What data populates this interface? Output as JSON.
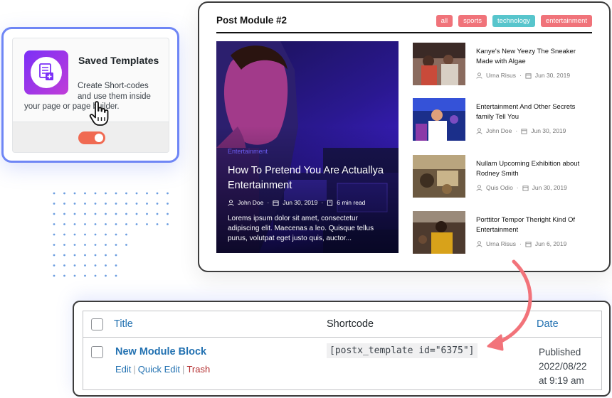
{
  "saved_templates": {
    "title": "Saved Templates",
    "description_line1": "Create Short-codes",
    "description_line2": "and use them inside",
    "description_line3": "your page or page builder.",
    "toggle_state": "on",
    "icon": "template-icon"
  },
  "post_module": {
    "title": "Post Module #2",
    "filters": [
      "all",
      "sports",
      "technology",
      "entertainment"
    ],
    "featured": {
      "category": "Entertainment",
      "headline": "How To Pretend You Are Actuallya Entertainment",
      "author": "John Doe",
      "date": "Jun 30, 2019",
      "read_time": "6 min read",
      "excerpt": "Lorems ipsum dolor sit amet, consectetur adipiscing elit. Maecenas a leo. Quisque tellus purus, volutpat eget justo quis, auctor..."
    },
    "posts": [
      {
        "title": "Kanye's New Yeezy The Sneaker Made with Algae",
        "author": "Urna Risus",
        "date": "Jun 30, 2019"
      },
      {
        "title": "Entertainment And Other Secrets family Tell You",
        "author": "John Doe",
        "date": "Jun 30, 2019"
      },
      {
        "title": "Nullam Upcoming Exhibition about Rodney Smith",
        "author": "Quis Odio",
        "date": "Jun 30, 2019"
      },
      {
        "title": "Porttitor Tempor Theright Kind Of Entertainment",
        "author": "Urna Risus",
        "date": "Jun 6, 2019"
      }
    ]
  },
  "table": {
    "columns": {
      "title": "Title",
      "shortcode": "Shortcode",
      "date": "Date"
    },
    "row": {
      "title": "New Module Block",
      "actions": {
        "edit": "Edit",
        "quick_edit": "Quick Edit",
        "trash": "Trash"
      },
      "shortcode": "[postx_template id=\"6375\"]",
      "date_status": "Published",
      "date_value": "2022/08/22",
      "date_time": "at 9:19 am"
    }
  },
  "colors": {
    "accent_blue": "#2271b1",
    "toggle": "#f06a52",
    "tab_pink": "#f0737a",
    "tab_teal": "#57c5cc",
    "arrow": "#f2737a",
    "card_border": "#6f86f5"
  }
}
